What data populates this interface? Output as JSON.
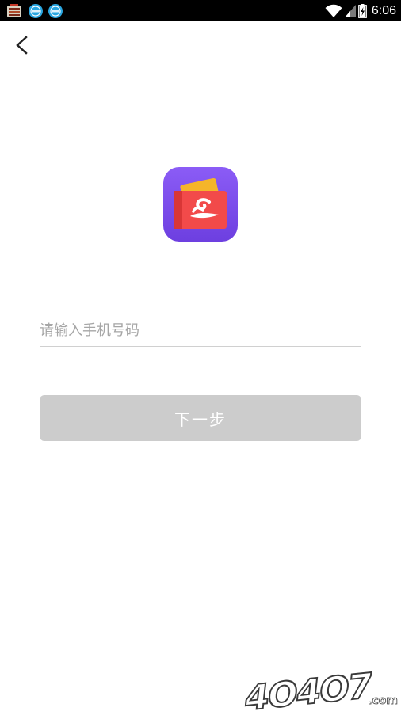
{
  "status_bar": {
    "time": "6:06",
    "icons": [
      "app-notification-icon",
      "browser-icon",
      "browser-icon",
      "wifi-icon",
      "signal-icon",
      "battery-charging-icon"
    ]
  },
  "navigation": {
    "back_icon": "chevron-left-icon"
  },
  "logo": {
    "icon": "app-logo-icon",
    "colors": {
      "background_top": "#8b5cf6",
      "background_bottom": "#6d3fe0",
      "card_back": "#f5b52a",
      "card_front": "#f24a4a"
    }
  },
  "phone": {
    "placeholder": "请输入手机号码",
    "value": ""
  },
  "next_button": {
    "label": "下一步",
    "color": "#cccccc"
  },
  "watermark": {
    "text": "4O4O7",
    "suffix": ".com"
  }
}
